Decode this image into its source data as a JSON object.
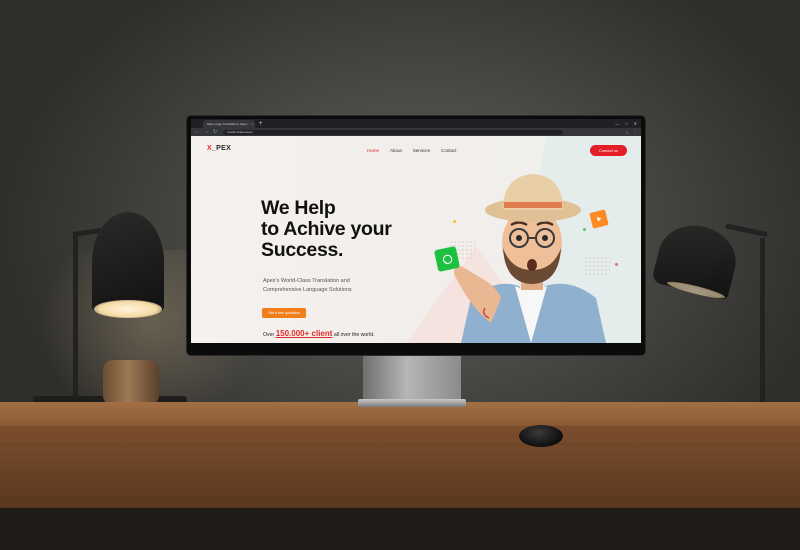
{
  "browser": {
    "tab_title": "Apex Lingo Translation | Apex...",
    "tab_close": "×",
    "new_tab": "+",
    "window_controls": [
      "—",
      "□",
      "✕"
    ],
    "nav_back": "←",
    "nav_forward": "→",
    "nav_reload": "↻",
    "url": "localhost/apexapex",
    "extension_icons": [
      "☆",
      "⋮"
    ]
  },
  "site": {
    "logo_mark": "X",
    "logo_text": "_PEX",
    "nav": {
      "home": "Home",
      "about": "About",
      "services": "Services",
      "contact": "Contact"
    },
    "contact_button": "Contact us",
    "hero": {
      "line1": "We Help",
      "line2": "to Achive your",
      "line3": "Success.",
      "subtitle_line1": "Apex's World-Class Translation and",
      "subtitle_line2": "Comprehensive Language Solutions",
      "cta": "Get a free quotation",
      "clients_prefix": "Over",
      "clients_number": "150.000+ client",
      "clients_suffix": " all over the world."
    },
    "colors": {
      "brand_red": "#e41e26",
      "cta_orange": "#f07e1a",
      "badge_green": "#1cc23f",
      "badge_orange": "#ff8a22"
    }
  }
}
